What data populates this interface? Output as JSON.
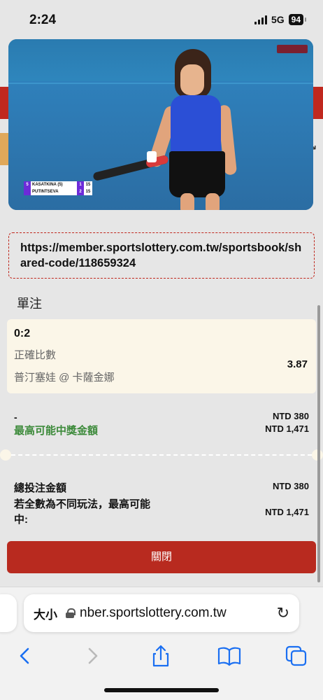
{
  "status_bar": {
    "time": "2:24",
    "network": "5G",
    "battery": "94"
  },
  "video": {
    "scoreboard": [
      {
        "seed": "5",
        "name": "KASATKINA (5)",
        "set": "1",
        "game": "15"
      },
      {
        "seed": "",
        "name": "PUTINTSEVA",
        "set": "2",
        "game": "15"
      }
    ]
  },
  "share_url": "https://member.sportslottery.com.tw/sportsbook/shared-code/118659324",
  "bet_slip": {
    "section_title": "單注",
    "bet": {
      "score": "0:2",
      "market": "正確比數",
      "selection": "普汀塞娃 @ 卡薩金娜",
      "odds": "3.87"
    },
    "stake_label": "-",
    "stake_amount": "NTD 380",
    "max_payout_label": "最高可能中獎金額",
    "max_payout_amount": "NTD 1,471",
    "total_stake_label": "總投注金額",
    "total_stake_amount": "NTD 380",
    "possible_win_label": "若全數為不同玩法，最高可能中:",
    "possible_win_amount": "NTD 1,471",
    "close_button": "關閉"
  },
  "browser": {
    "text_size_label": "大小",
    "address": "nber.sportslottery.com.tw"
  }
}
